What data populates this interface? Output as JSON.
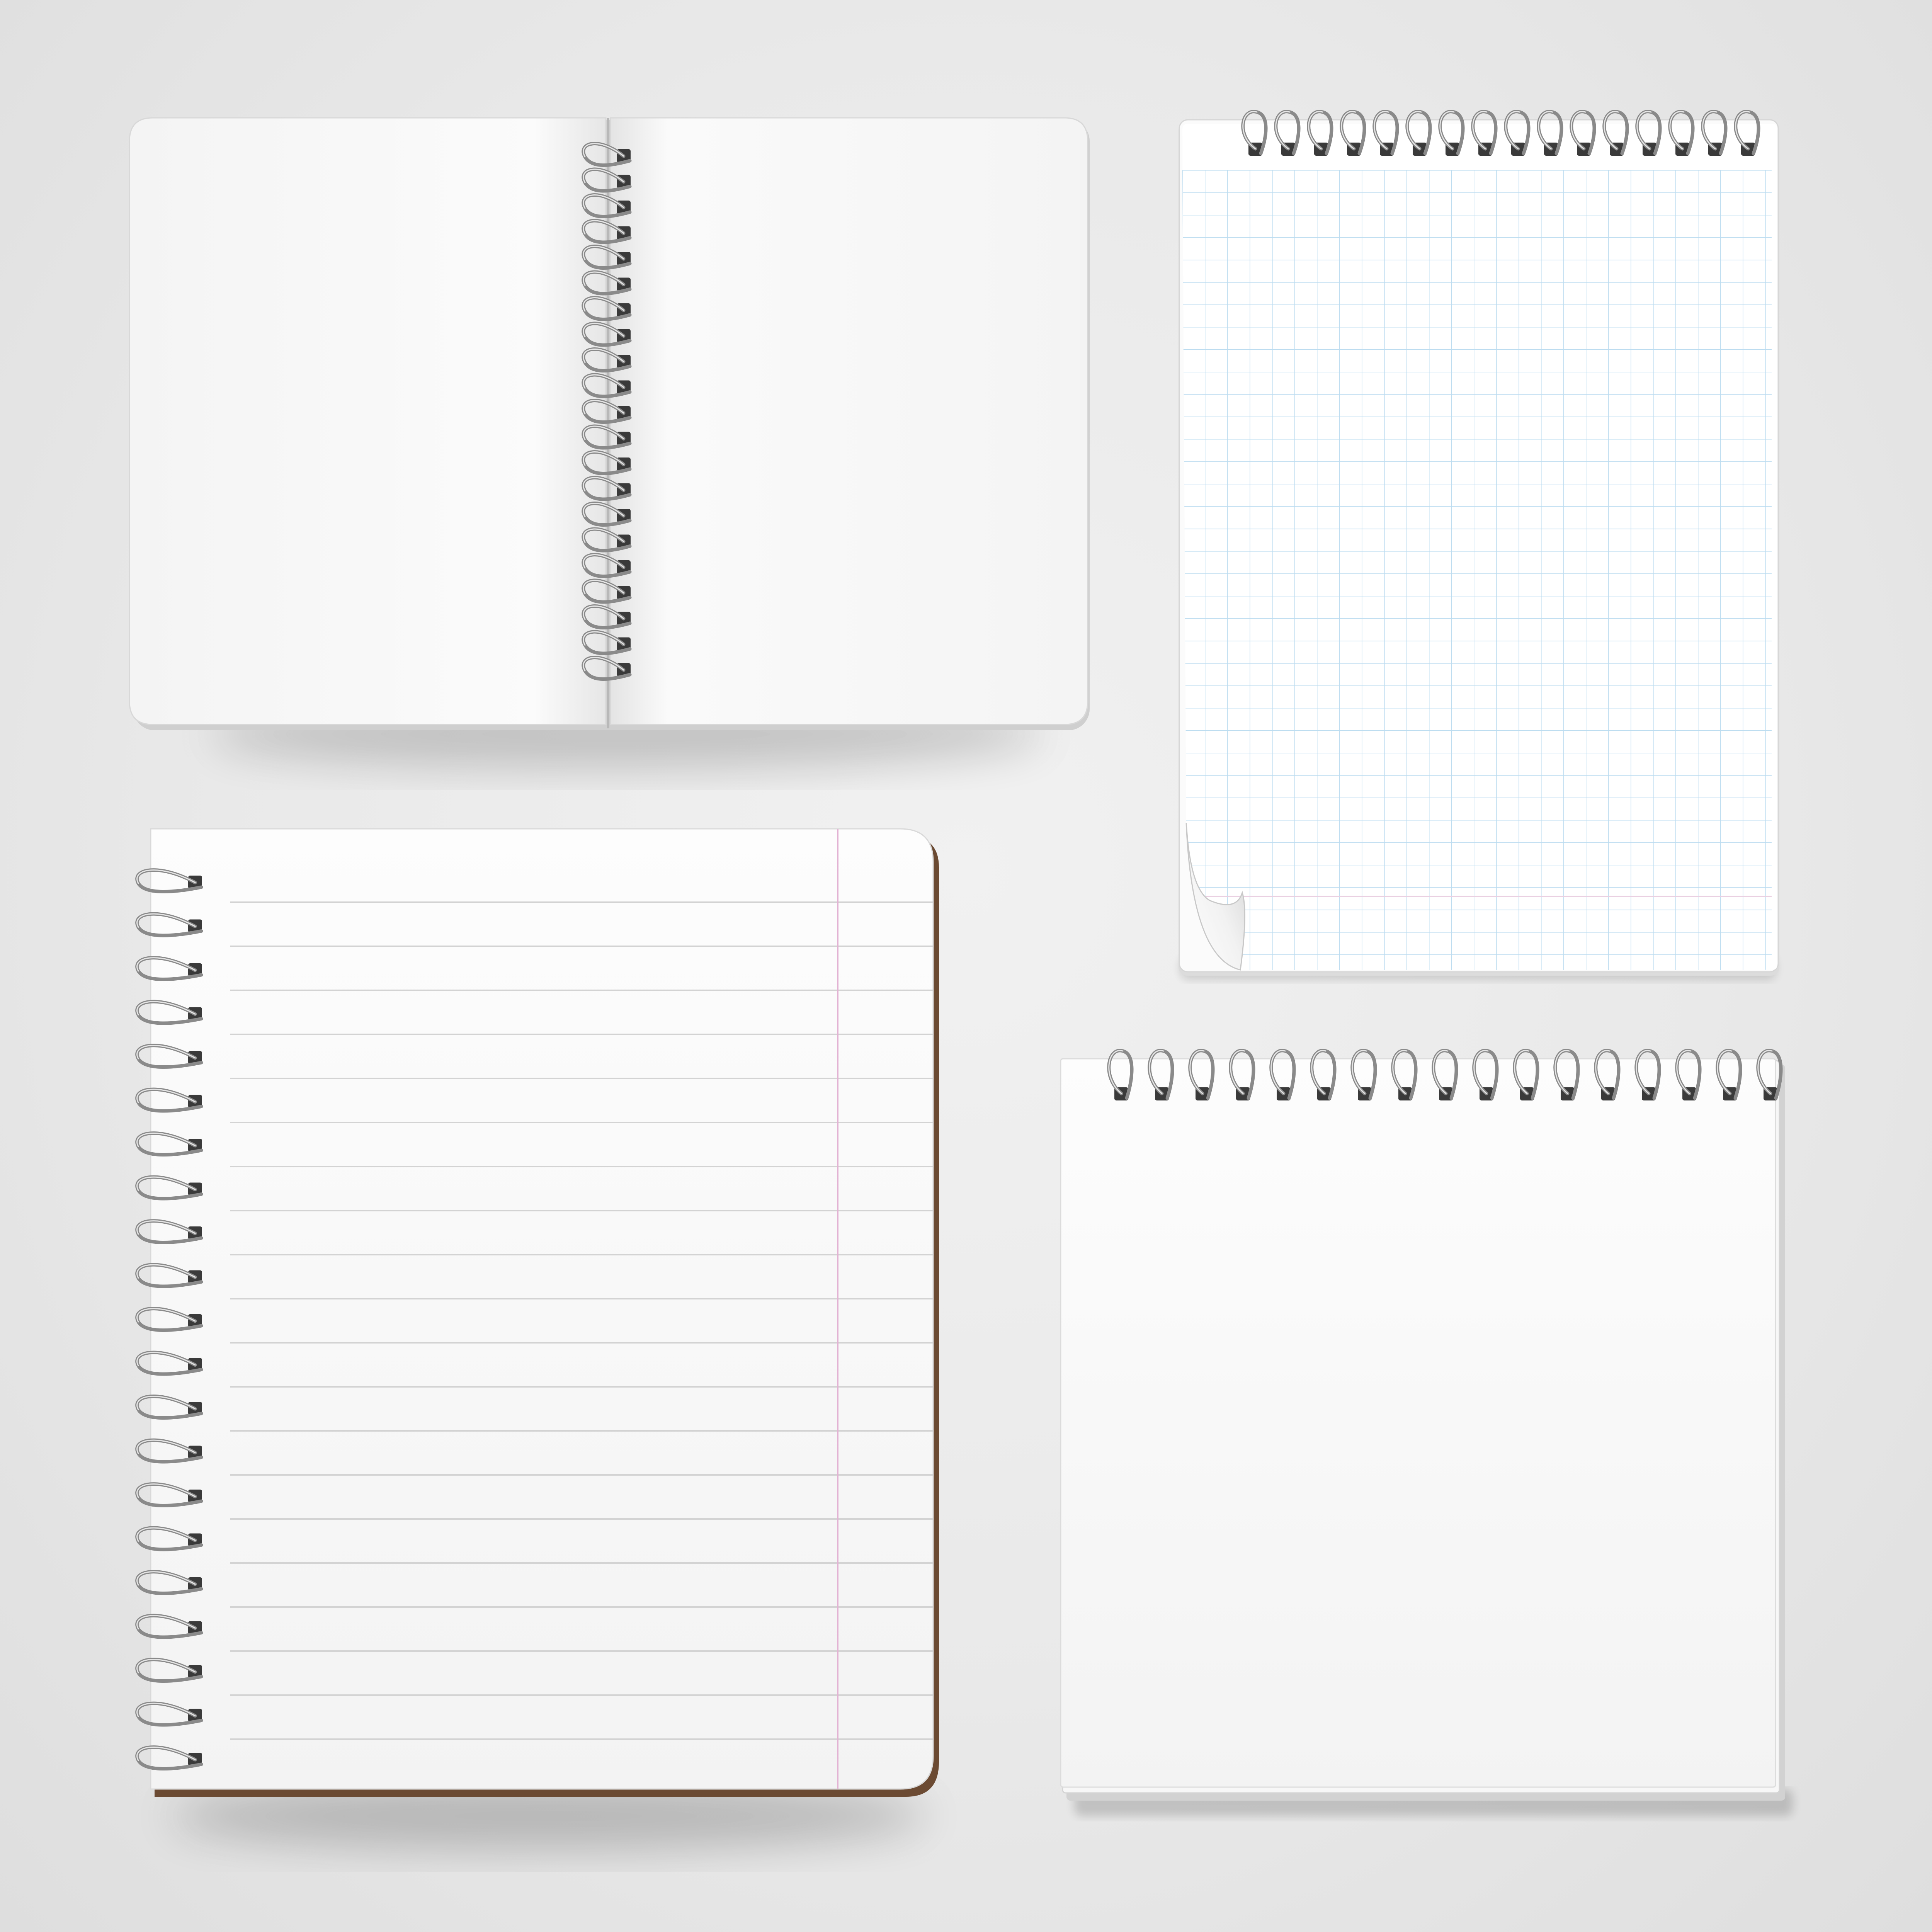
{
  "scene": {
    "background_color": "#e8e8e8",
    "paper_color": "#ffffff",
    "ring_color": "#8a8a8a",
    "ring_hole_color": "#3a3a3a",
    "ruled_line_color": "#d3d3d3",
    "grid_line_color": "#bcdcf0",
    "margin_line_color": "#e8b4d6",
    "back_cover_color": "#6b4a32"
  },
  "objects": [
    {
      "name": "open-spiral-notebook",
      "binding": "center",
      "paper": "blank",
      "ring_count": 21
    },
    {
      "name": "grid-spiral-notepad",
      "binding": "top",
      "paper": "grid",
      "ring_count": 16,
      "corner": "curled-bottom-left"
    },
    {
      "name": "lined-spiral-notebook",
      "binding": "left",
      "paper": "ruled",
      "ring_count": 21,
      "cover": "brown"
    },
    {
      "name": "blank-spiral-notepad",
      "binding": "top",
      "paper": "blank",
      "ring_count": 17
    }
  ]
}
